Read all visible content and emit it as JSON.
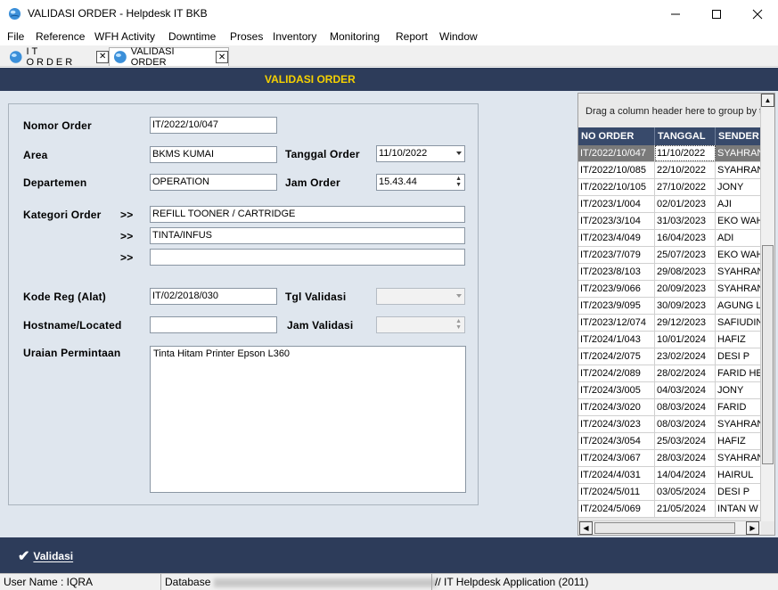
{
  "window": {
    "title": "VALIDASI ORDER - Helpdesk IT BKB",
    "minimize": "—",
    "maximize": "☐",
    "close": "✕"
  },
  "menu": [
    "File",
    "Reference",
    "WFH Activity",
    "Downtime",
    "Proses",
    "Inventory",
    "Monitoring",
    "Report",
    "Window"
  ],
  "tabs": [
    {
      "label": "IT ORDER",
      "close": "✕"
    },
    {
      "label": "VALIDASI ORDER",
      "close": "✕"
    }
  ],
  "header": {
    "title": "VALIDASI ORDER"
  },
  "form": {
    "nomor_order": {
      "label": "Nomor Order",
      "value": "IT/2022/10/047"
    },
    "area": {
      "label": "Area",
      "value": "BKMS KUMAI"
    },
    "tanggal_order": {
      "label": "Tanggal Order",
      "value": "11/10/2022"
    },
    "departemen": {
      "label": "Departemen",
      "value": "OPERATION"
    },
    "jam_order": {
      "label": "Jam Order",
      "value": "15.43.44"
    },
    "kategori_order": {
      "label": "Kategori Order",
      "arrow": ">>",
      "values": [
        "REFILL TOONER / CARTRIDGE",
        "TINTA/INFUS",
        ""
      ]
    },
    "kode_reg": {
      "label": "Kode Reg (Alat)",
      "value": "IT/02/2018/030"
    },
    "tgl_validasi": {
      "label": "Tgl Validasi",
      "value": ""
    },
    "hostname": {
      "label": "Hostname/Located",
      "value": ""
    },
    "jam_validasi": {
      "label": "Jam Validasi",
      "value": ""
    },
    "uraian": {
      "label": "Uraian Permintaan",
      "value": "Tinta Hitam Printer Epson L360"
    }
  },
  "grid": {
    "group_hint": "Drag a column header here to group by t",
    "columns": [
      "NO ORDER",
      "TANGGAL",
      "SENDER"
    ],
    "rows": [
      [
        "IT/2022/10/047",
        "11/10/2022",
        "SYAHRAN"
      ],
      [
        "IT/2022/10/085",
        "22/10/2022",
        "SYAHRAN"
      ],
      [
        "IT/2022/10/105",
        "27/10/2022",
        "JONY"
      ],
      [
        "IT/2023/1/004",
        "02/01/2023",
        "AJI"
      ],
      [
        "IT/2023/3/104",
        "31/03/2023",
        "EKO WAH"
      ],
      [
        "IT/2023/4/049",
        "16/04/2023",
        "ADI"
      ],
      [
        "IT/2023/7/079",
        "25/07/2023",
        "EKO WAH"
      ],
      [
        "IT/2023/8/103",
        "29/08/2023",
        "SYAHRAN"
      ],
      [
        "IT/2023/9/066",
        "20/09/2023",
        "SYAHRAN"
      ],
      [
        "IT/2023/9/095",
        "30/09/2023",
        "AGUNG L"
      ],
      [
        "IT/2023/12/074",
        "29/12/2023",
        "SAFIUDIN"
      ],
      [
        "IT/2024/1/043",
        "10/01/2024",
        "HAFIZ"
      ],
      [
        "IT/2024/2/075",
        "23/02/2024",
        "DESI P"
      ],
      [
        "IT/2024/2/089",
        "28/02/2024",
        "FARID HE"
      ],
      [
        "IT/2024/3/005",
        "04/03/2024",
        "JONY"
      ],
      [
        "IT/2024/3/020",
        "08/03/2024",
        "FARID"
      ],
      [
        "IT/2024/3/023",
        "08/03/2024",
        "SYAHRAN"
      ],
      [
        "IT/2024/3/054",
        "25/03/2024",
        "HAFIZ"
      ],
      [
        "IT/2024/3/067",
        "28/03/2024",
        "SYAHRAN"
      ],
      [
        "IT/2024/4/031",
        "14/04/2024",
        "HAIRUL"
      ],
      [
        "IT/2024/5/011",
        "03/05/2024",
        "DESI P"
      ],
      [
        "IT/2024/5/069",
        "21/05/2024",
        "INTAN W"
      ]
    ]
  },
  "actions": {
    "validasi": "Validasi"
  },
  "status": {
    "user": "User Name : IQRA",
    "database": "Database",
    "app": "// IT Helpdesk Application (2011)"
  }
}
